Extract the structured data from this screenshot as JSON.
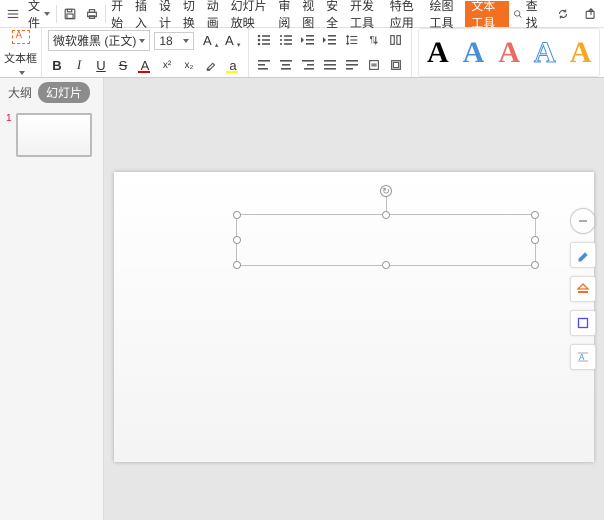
{
  "menu": {
    "toggle_label": "文件",
    "tabs": [
      "开始",
      "插入",
      "设计",
      "切换",
      "动画",
      "幻灯片放映",
      "审阅",
      "视图",
      "安全",
      "开发工具",
      "特色应用",
      "绘图工具",
      "文本工具"
    ],
    "active_tab": "文本工具",
    "search": "查找"
  },
  "ribbon": {
    "textbox_label": "文本框",
    "font_name": "微软雅黑 (正文)",
    "font_size": "18"
  },
  "left_pane": {
    "tabs": {
      "outline": "大纲",
      "slides": "幻灯片"
    },
    "slide_number": "1"
  },
  "presets": [
    "A",
    "A",
    "A",
    "A",
    "A"
  ]
}
